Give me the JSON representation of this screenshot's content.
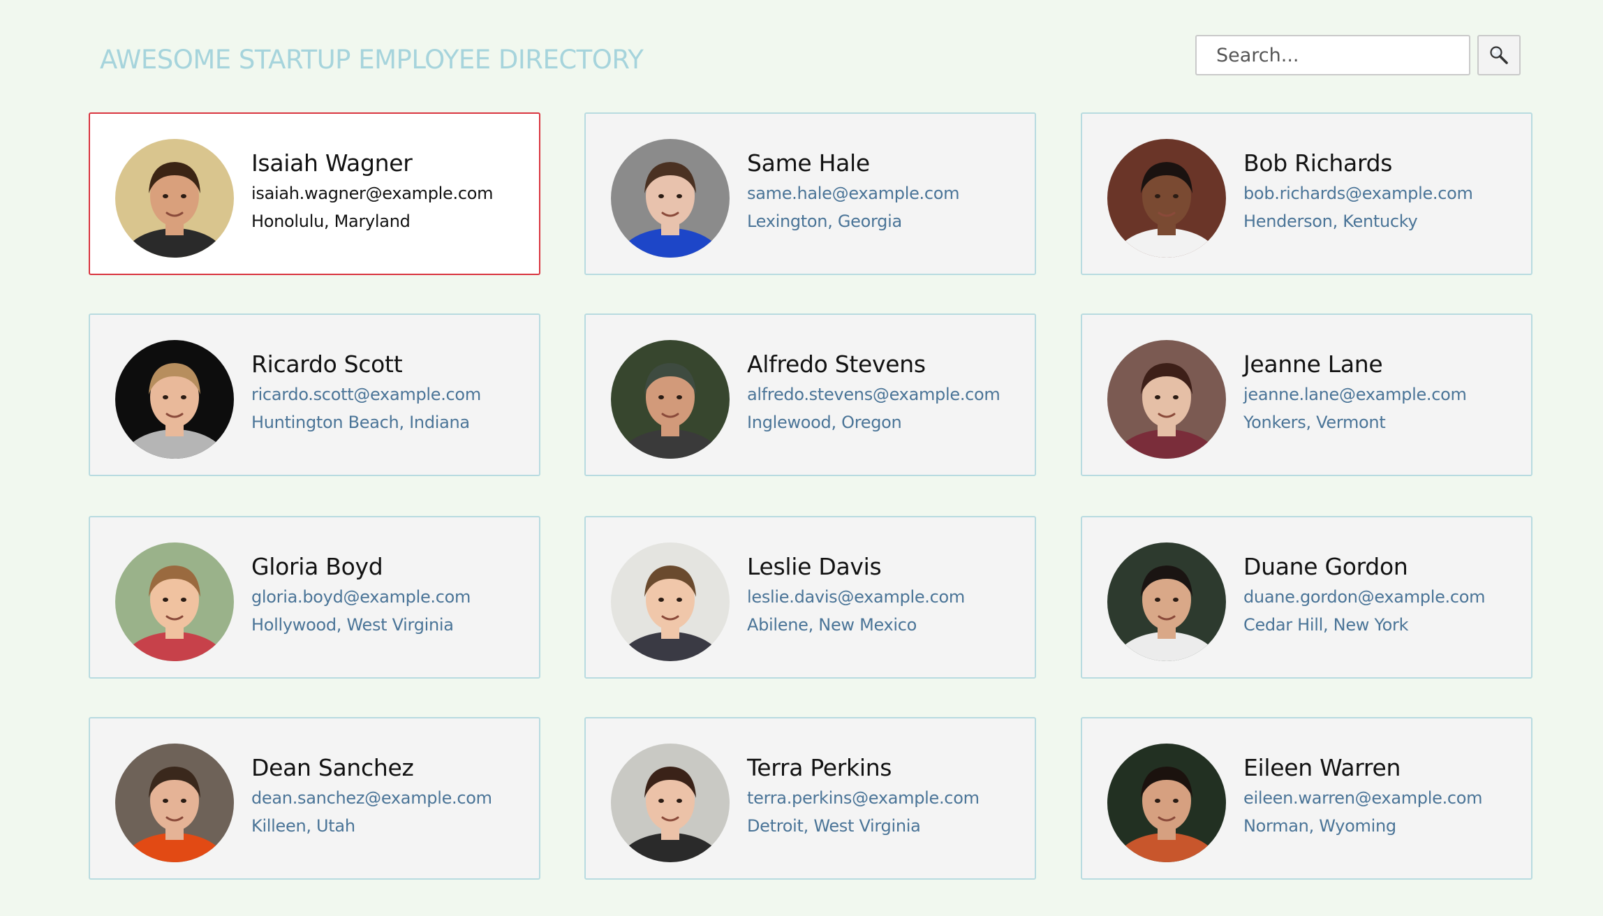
{
  "header": {
    "title": "AWESOME STARTUP EMPLOYEE DIRECTORY",
    "search_placeholder": "Search...",
    "search_icon": "magnifying-glass-icon"
  },
  "employees": [
    {
      "name": "Isaiah Wagner",
      "email": "isaiah.wagner@example.com",
      "location": "Honolulu, Maryland",
      "selected": true,
      "photo": {
        "bg": "#d9c58e",
        "skin": "#d9a07c",
        "hair": "#3b2414",
        "shirt": "#2a2a2a"
      }
    },
    {
      "name": "Same Hale",
      "email": "same.hale@example.com",
      "location": "Lexington, Georgia",
      "selected": false,
      "photo": {
        "bg": "#8b8b8b",
        "skin": "#e8c2ad",
        "hair": "#4a3122",
        "shirt": "#1d46c8"
      }
    },
    {
      "name": "Bob Richards",
      "email": "bob.richards@example.com",
      "location": "Henderson, Kentucky",
      "selected": false,
      "photo": {
        "bg": "#6a3528",
        "skin": "#7a4a32",
        "hair": "#1a1210",
        "shirt": "#f2f2f2"
      }
    },
    {
      "name": "Ricardo Scott",
      "email": "ricardo.scott@example.com",
      "location": "Huntington Beach, Indiana",
      "selected": false,
      "photo": {
        "bg": "#0d0d0d",
        "skin": "#e9b99a",
        "hair": "#b78e5e",
        "shirt": "#b5b5b5"
      }
    },
    {
      "name": "Alfredo Stevens",
      "email": "alfredo.stevens@example.com",
      "location": "Inglewood, Oregon",
      "selected": false,
      "photo": {
        "bg": "#37462e",
        "skin": "#d29a7a",
        "hair": "#3e4b40",
        "shirt": "#3a3a3a"
      }
    },
    {
      "name": "Jeanne Lane",
      "email": "jeanne.lane@example.com",
      "location": "Yonkers, Vermont",
      "selected": false,
      "photo": {
        "bg": "#7b5a52",
        "skin": "#e5bfa6",
        "hair": "#3d1f18",
        "shirt": "#7a2d3a"
      }
    },
    {
      "name": "Gloria Boyd",
      "email": "gloria.boyd@example.com",
      "location": "Hollywood, West Virginia",
      "selected": false,
      "photo": {
        "bg": "#9ab28a",
        "skin": "#f0c2a0",
        "hair": "#9a6a3f",
        "shirt": "#c7414a"
      }
    },
    {
      "name": "Leslie Davis",
      "email": "leslie.davis@example.com",
      "location": "Abilene, New Mexico",
      "selected": false,
      "photo": {
        "bg": "#e4e4e0",
        "skin": "#f0c7aa",
        "hair": "#6a4a2e",
        "shirt": "#3a3a44"
      }
    },
    {
      "name": "Duane Gordon",
      "email": "duane.gordon@example.com",
      "location": "Cedar Hill, New York",
      "selected": false,
      "photo": {
        "bg": "#2d3a2e",
        "skin": "#d9a888",
        "hair": "#1a1412",
        "shirt": "#ececec"
      }
    },
    {
      "name": "Dean Sanchez",
      "email": "dean.sanchez@example.com",
      "location": "Killeen, Utah",
      "selected": false,
      "photo": {
        "bg": "#6e6258",
        "skin": "#e5b396",
        "hair": "#3a281c",
        "shirt": "#e24a14"
      }
    },
    {
      "name": "Terra Perkins",
      "email": "terra.perkins@example.com",
      "location": "Detroit, West Virginia",
      "selected": false,
      "photo": {
        "bg": "#c9c9c4",
        "skin": "#ecc2a8",
        "hair": "#3a2218",
        "shirt": "#2a2a2a"
      }
    },
    {
      "name": "Eileen Warren",
      "email": "eileen.warren@example.com",
      "location": "Norman, Wyoming",
      "selected": false,
      "photo": {
        "bg": "#223022",
        "skin": "#d6a080",
        "hair": "#1b120e",
        "shirt": "#c8562c"
      }
    }
  ]
}
